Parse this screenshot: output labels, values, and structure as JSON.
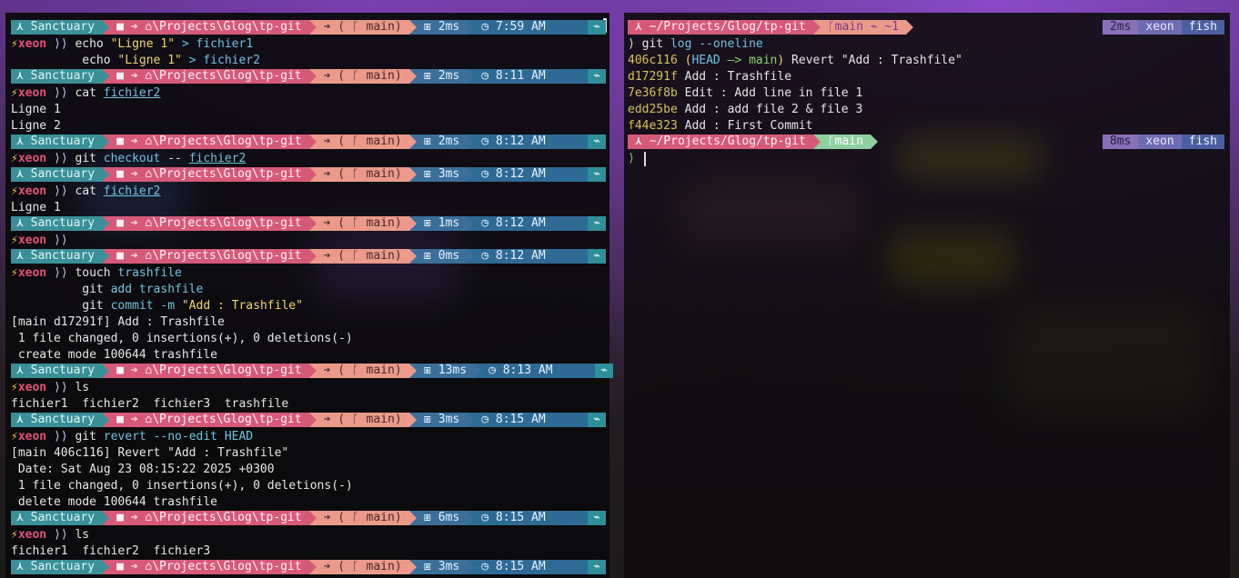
{
  "left": {
    "seg_sanct": "⋏ Sanctuary",
    "seg_path": "■ ➔ ⌂\\Projects\\Glog\\tp-git",
    "seg_branch": "➔ ( ᚴ main)",
    "seg_end": "⌁",
    "time_icon": "⧆",
    "clock_icon": "◷",
    "user": "⚡xeon",
    "chev": "⟩⟩",
    "prompts": [
      {
        "time": "2ms",
        "clock": "7:59 AM"
      },
      {
        "time": "2ms",
        "clock": "8:11 AM"
      },
      {
        "time": "2ms",
        "clock": "8:12 AM"
      },
      {
        "time": "3ms",
        "clock": "8:12 AM"
      },
      {
        "time": "1ms",
        "clock": "8:12 AM"
      },
      {
        "time": "0ms",
        "clock": "8:12 AM"
      },
      {
        "time": "13ms",
        "clock": "8:13 AM"
      },
      {
        "time": "3ms",
        "clock": "8:15 AM"
      },
      {
        "time": "6ms",
        "clock": "8:15 AM"
      },
      {
        "time": "3ms",
        "clock": "8:15 AM"
      }
    ],
    "l1a": "echo ",
    "l1b": "\"Ligne 1\"",
    "l1c": " > ",
    "l1d": "fichier1",
    "l2a": "echo ",
    "l2b": "\"Ligne 1\"",
    "l2c": " > ",
    "l2d": "fichier2",
    "cat": "cat ",
    "fichier2": "fichier2",
    "out_ligne1": "Ligne 1",
    "out_ligne2": "Ligne 2",
    "git": "git ",
    "checkout": "checkout",
    "dashdash": " -- ",
    "touch": "touch ",
    "trashfile": "trashfile",
    "add": "add ",
    "commit": "commit",
    "m_flag": " -m ",
    "commit_msg": "\"Add : Trashfile\"",
    "commit_out1": "[main d17291f] Add : Trashfile",
    "commit_out2": " 1 file changed, 0 insertions(+), 0 deletions(-)",
    "commit_out3": " create mode 100644 trashfile",
    "ls": "ls",
    "ls_out1": "fichier1  fichier2  fichier3  trashfile",
    "revert": "revert",
    "revert_args": " --no-edit HEAD",
    "revert_out1": "[main 406c116] Revert \"Add : Trashfile\"",
    "revert_out2": " Date: Sat Aug 23 08:15:22 2025 +0300",
    "revert_out3": " 1 file changed, 0 insertions(+), 0 deletions(-)",
    "revert_out4": " delete mode 100644 trashfile",
    "ls_out2": "fichier1  fichier2  fichier3"
  },
  "right": {
    "path": "⋏ ~/Projects/Glog/tp-git",
    "branch1": "ᚴmain ⌁ ~1",
    "branch2": "ᚴmain",
    "time1": "2ms",
    "time2": "8ms",
    "host": "xeon",
    "shell": "fish",
    "prompt_glyph": "⟩",
    "cmd_git": "git ",
    "cmd_log": "log",
    "cmd_flag": " --oneline",
    "log": [
      {
        "hash": "406c116",
        "msg": " Revert \"Add : Trashfile\""
      },
      {
        "hash": "d17291f",
        "msg": " Add : Trashfile"
      },
      {
        "hash": "7e36f8b",
        "msg": " Edit : Add line in file 1"
      },
      {
        "hash": "edd25be",
        "msg": " Add : add file 2 & file 3"
      },
      {
        "hash": "f44e323",
        "msg": " Add : First Commit"
      }
    ],
    "head_open": " (",
    "head_label": "HEAD",
    "head_arrow": " —> ",
    "head_main": "main",
    "head_close": ")"
  },
  "colors": {
    "sanctuary": "#3a8f98",
    "path": "#d65a78",
    "branch": "#eb9a8a",
    "time": "#3b6f9a",
    "right_time": "#8a70b8",
    "right_host": "#6d6cb2",
    "right_shell": "#4b5fa0"
  }
}
